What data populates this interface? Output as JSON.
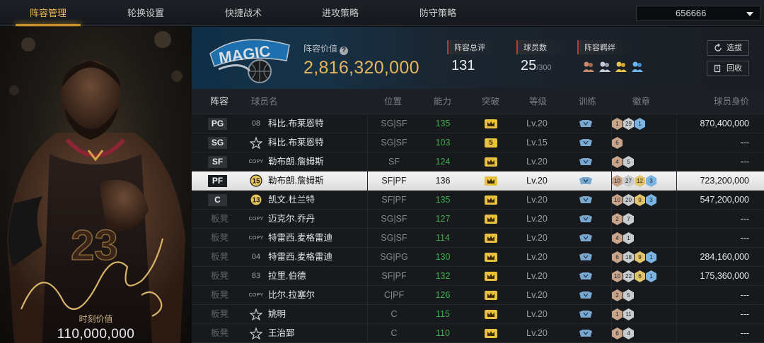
{
  "tabs": [
    {
      "label": "阵容管理",
      "active": true
    },
    {
      "label": "轮换设置",
      "active": false
    },
    {
      "label": "快捷战术",
      "active": false
    },
    {
      "label": "进攻策略",
      "active": false
    },
    {
      "label": "防守策略",
      "active": false
    }
  ],
  "lineup_selector": {
    "value": "656666"
  },
  "player_card": {
    "value_label": "时刻价值",
    "value": "110,000,000"
  },
  "team": {
    "logo_text": "MAGIC"
  },
  "lineup_value": {
    "label": "阵容价值",
    "value": "2,816,320,000"
  },
  "stats": {
    "rating": {
      "label": "阵容总评",
      "value": "131"
    },
    "players": {
      "label": "球员数",
      "value": "25",
      "max": "/300"
    },
    "bond": {
      "label": "阵容羁绊",
      "icons": [
        "bond-icon-bronze",
        "bond-icon-silver",
        "bond-icon-gold",
        "bond-icon-blue"
      ]
    }
  },
  "buttons": {
    "draft": "选拔",
    "recycle": "回收"
  },
  "columns": [
    "阵容",
    "球员名",
    "位置",
    "能力",
    "突破",
    "等级",
    "训练",
    "徽章",
    "球员身价"
  ],
  "rows": [
    {
      "slot": "PG",
      "tag": "08",
      "tag_type": "number",
      "name": "科比.布莱恩特",
      "position": "SG|SF",
      "ability": "135",
      "breakthrough": "crown",
      "level": "Lv.20",
      "badges": [
        {
          "c": "b",
          "v": "1"
        },
        {
          "c": "s",
          "v": "29"
        },
        {
          "c": "p",
          "v": "1"
        }
      ],
      "value": "870,400,000"
    },
    {
      "slot": "SG",
      "tag": "",
      "tag_type": "star",
      "name": "科比.布莱恩特",
      "position": "SG|SF",
      "ability": "103",
      "breakthrough": "5",
      "level": "Lv.15",
      "badges": [
        {
          "c": "b",
          "v": "6"
        }
      ],
      "value": "---"
    },
    {
      "slot": "SF",
      "tag": "COPY",
      "tag_type": "copy",
      "name": "勒布朗.詹姆斯",
      "position": "SF",
      "ability": "124",
      "breakthrough": "crown",
      "level": "Lv.20",
      "badges": [
        {
          "c": "b",
          "v": "4"
        },
        {
          "c": "s",
          "v": "5"
        }
      ],
      "value": "---"
    },
    {
      "slot": "PF",
      "tag": "15",
      "tag_type": "medal",
      "name": "勒布朗.詹姆斯",
      "position": "SF|PF",
      "ability": "136",
      "breakthrough": "crown",
      "level": "Lv.20",
      "badges": [
        {
          "c": "b",
          "v": "10"
        },
        {
          "c": "s",
          "v": "27"
        },
        {
          "c": "g",
          "v": "12"
        },
        {
          "c": "p",
          "v": "3"
        }
      ],
      "value": "723,200,000",
      "selected": true
    },
    {
      "slot": "C",
      "tag": "13",
      "tag_type": "medal",
      "name": "凯文.杜兰特",
      "position": "SF|PF",
      "ability": "135",
      "breakthrough": "crown",
      "level": "Lv.20",
      "badges": [
        {
          "c": "b",
          "v": "10"
        },
        {
          "c": "s",
          "v": "20"
        },
        {
          "c": "g",
          "v": "9"
        },
        {
          "c": "p",
          "v": "3"
        }
      ],
      "value": "547,200,000"
    },
    {
      "slot": "板凳",
      "tag": "COPY",
      "tag_type": "copy",
      "name": "迈克尔.乔丹",
      "position": "SG|SF",
      "ability": "127",
      "breakthrough": "crown",
      "level": "Lv.20",
      "badges": [
        {
          "c": "b",
          "v": "2"
        },
        {
          "c": "s",
          "v": "7"
        }
      ],
      "value": "---"
    },
    {
      "slot": "板凳",
      "tag": "COPY",
      "tag_type": "copy",
      "name": "特雷西.麦格雷迪",
      "position": "SG|SF",
      "ability": "114",
      "breakthrough": "crown",
      "level": "Lv.20",
      "badges": [
        {
          "c": "b",
          "v": "4"
        },
        {
          "c": "s",
          "v": "1"
        }
      ],
      "value": "---"
    },
    {
      "slot": "板凳",
      "tag": "04",
      "tag_type": "number",
      "name": "特雷西.麦格雷迪",
      "position": "SG|PG",
      "ability": "130",
      "breakthrough": "crown",
      "level": "Lv.20",
      "badges": [
        {
          "c": "b",
          "v": "6"
        },
        {
          "c": "s",
          "v": "18"
        },
        {
          "c": "g",
          "v": "9"
        },
        {
          "c": "p",
          "v": "1"
        }
      ],
      "value": "284,160,000"
    },
    {
      "slot": "板凳",
      "tag": "83",
      "tag_type": "number",
      "name": "拉里.伯德",
      "position": "SF|PF",
      "ability": "132",
      "breakthrough": "crown",
      "level": "Lv.20",
      "badges": [
        {
          "c": "b",
          "v": "10"
        },
        {
          "c": "s",
          "v": "22"
        },
        {
          "c": "g",
          "v": "6"
        },
        {
          "c": "p",
          "v": "1"
        }
      ],
      "value": "175,360,000"
    },
    {
      "slot": "板凳",
      "tag": "COPY",
      "tag_type": "copy",
      "name": "比尔.拉塞尔",
      "position": "C|PF",
      "ability": "126",
      "breakthrough": "crown",
      "level": "Lv.20",
      "badges": [
        {
          "c": "b",
          "v": "2"
        },
        {
          "c": "s",
          "v": "5"
        }
      ],
      "value": "---"
    },
    {
      "slot": "板凳",
      "tag": "",
      "tag_type": "star",
      "name": "姚明",
      "position": "C",
      "ability": "115",
      "breakthrough": "crown",
      "level": "Lv.20",
      "badges": [
        {
          "c": "b",
          "v": "1"
        },
        {
          "c": "s",
          "v": "11"
        }
      ],
      "value": "---"
    },
    {
      "slot": "板凳",
      "tag": "",
      "tag_type": "star",
      "name": "王治郅",
      "position": "C",
      "ability": "110",
      "breakthrough": "crown",
      "level": "Lv.20",
      "badges": [
        {
          "c": "b",
          "v": "6"
        },
        {
          "c": "s",
          "v": "4"
        }
      ],
      "value": "---"
    }
  ],
  "colors": {
    "accent": "#e8b65a",
    "ability_green": "#3fae4c",
    "crown": "#e7c13f",
    "bg": "#17191c"
  }
}
